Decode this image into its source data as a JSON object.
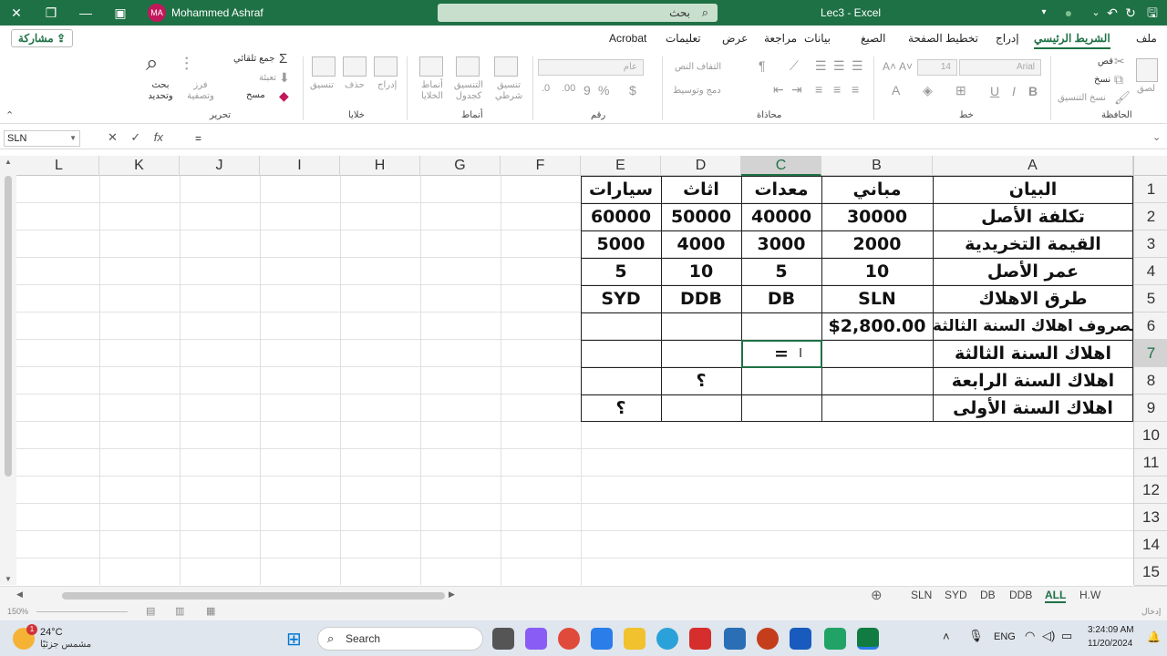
{
  "titlebar": {
    "user": "Mohammed Ashraf",
    "initials": "MA",
    "search_placeholder": "بحث",
    "doc_title": "Lec3 - Excel"
  },
  "share_label": "مشاركة",
  "tabs": [
    "ملف",
    "الشريط الرئيسي",
    "إدراج",
    "تخطيط الصفحة",
    "الصيغ",
    "بيانات",
    "مراجعة",
    "عرض",
    "تعليمات",
    "Acrobat"
  ],
  "ribbon": {
    "groups": [
      "الحافظة",
      "خط",
      "محاذاة",
      "رقم",
      "أنماط",
      "خلايا",
      "تحرير"
    ],
    "clipboard": {
      "paste": "لصق",
      "cut": "قص",
      "copy": "نسخ",
      "format_painter": "نسخ التنسيق"
    },
    "font": {
      "name": "Arial",
      "size": "14"
    },
    "alignment": {
      "wrap": "التفاف النص",
      "merge": "دمج وتوسيط"
    },
    "number": {
      "format": "عام"
    },
    "styles": {
      "conditional": "تنسيق شرطي",
      "as_table": "التنسيق كجدول",
      "cell_styles": "أنماط الخلايا"
    },
    "cells": {
      "insert": "إدراج",
      "delete": "حذف",
      "format": "تنسيق"
    },
    "editing": {
      "autosum": "جمع تلقائي",
      "fill": "تعبئة",
      "clear": "مسح",
      "sort": "فرز وتصفية",
      "find": "بحث وتحديد"
    }
  },
  "formula_bar": {
    "name_box": "SLN",
    "formula": "=",
    "fx": "fx"
  },
  "columns": [
    "A",
    "B",
    "C",
    "D",
    "E",
    "F",
    "G",
    "H",
    "I",
    "J",
    "K",
    "L"
  ],
  "rows": [
    "1",
    "2",
    "3",
    "4",
    "5",
    "6",
    "7",
    "8",
    "9",
    "10",
    "11",
    "12",
    "13",
    "14",
    "15"
  ],
  "table": {
    "row1": [
      "البيان",
      "مباني",
      "معدات",
      "اثاث",
      "سيارات"
    ],
    "row2": [
      "تكلفة الأصل",
      "30000",
      "40000",
      "50000",
      "60000"
    ],
    "row3": [
      "القيمة التخريدية",
      "2000",
      "3000",
      "4000",
      "5000"
    ],
    "row4": [
      "عمر الأصل",
      "10",
      "5",
      "10",
      "5"
    ],
    "row5": [
      "طرق الاهلاك",
      "SLN",
      "DB",
      "DDB",
      "SYD"
    ],
    "row6": [
      "مصروف اهلاك السنة الثالثة",
      "$2,800.00"
    ],
    "row7": [
      "اهلاك السنة الثالثة",
      "="
    ],
    "row8": [
      "اهلاك السنة الرابعة",
      "؟"
    ],
    "row9": [
      "اهلاك السنة الأولى",
      "؟"
    ]
  },
  "sheet_tabs": [
    "SLN",
    "SYD",
    "DB",
    "DDB",
    "ALL",
    "H.W"
  ],
  "active_sheet": "ALL",
  "status": {
    "mode": "إدخال",
    "zoom": "150%"
  },
  "taskbar": {
    "temp": "24°C",
    "weather": "مشمس جزئيًا",
    "search": "Search",
    "lang": "ENG",
    "time": "3:24:09 AM",
    "date": "11/20/2024",
    "badge": "1"
  },
  "colors": {
    "excel_green": "#1e7145"
  }
}
